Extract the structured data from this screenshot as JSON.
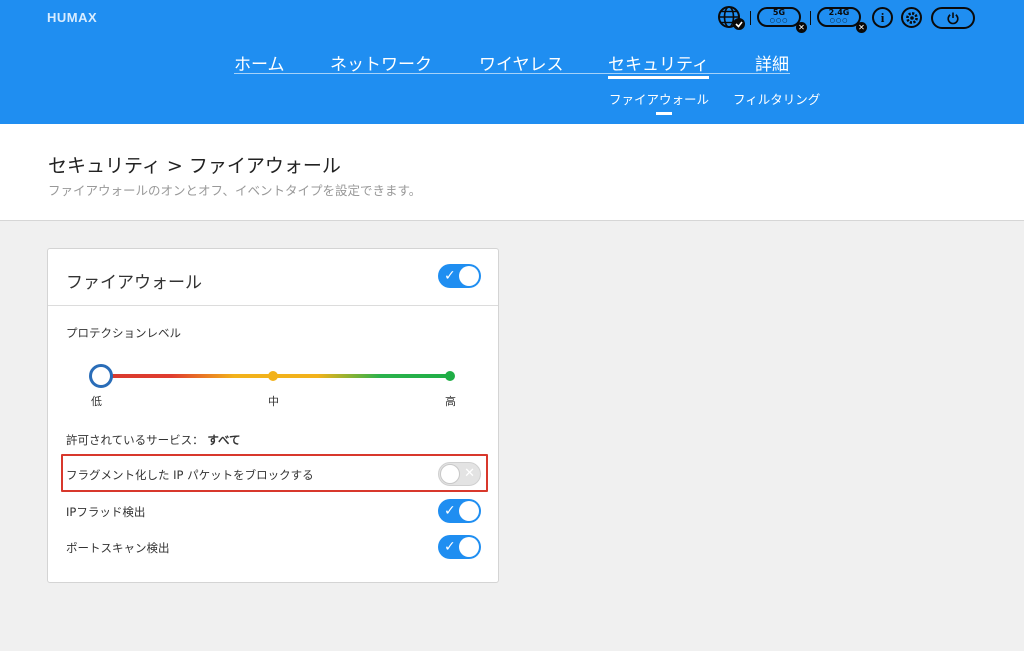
{
  "header": {
    "brand": "HUMAX",
    "nav": [
      "ホーム",
      "ネットワーク",
      "ワイヤレス",
      "セキュリティ",
      "詳細"
    ],
    "active_nav": "セキュリティ",
    "subnav": [
      "ファイアウォール",
      "フィルタリング"
    ],
    "icons": {
      "internet": "globe-icon",
      "wifi5g_label": "5G",
      "wifi24g_label": "2.4G",
      "info": "i",
      "settings": "gear-icon",
      "power": "power-icon"
    }
  },
  "page": {
    "title": "セキュリティ > ファイアウォール",
    "description": "ファイアウォールのオンとオフ、イベントタイプを設定できます。"
  },
  "card": {
    "title": "ファイアウォール",
    "enabled": true,
    "protection_label": "プロテクションレベル",
    "levels": [
      "低",
      "中",
      "高"
    ],
    "selected_level": "低",
    "allowed_services_label": "許可されているサービス：",
    "allowed_services_value": "すべて",
    "options": [
      {
        "label": "フラグメント化した IP パケットをブロックする",
        "enabled": false
      },
      {
        "label": "IPフラッド検出",
        "enabled": true
      },
      {
        "label": "ポートスキャン検出",
        "enabled": true
      }
    ]
  },
  "colors": {
    "header_bg": "#1f8ef1",
    "toggle_on": "#1f8ef1",
    "level_low": "#d93a2e",
    "level_mid": "#f2b21b",
    "level_high": "#1fae46",
    "highlight": "#d8382c"
  }
}
